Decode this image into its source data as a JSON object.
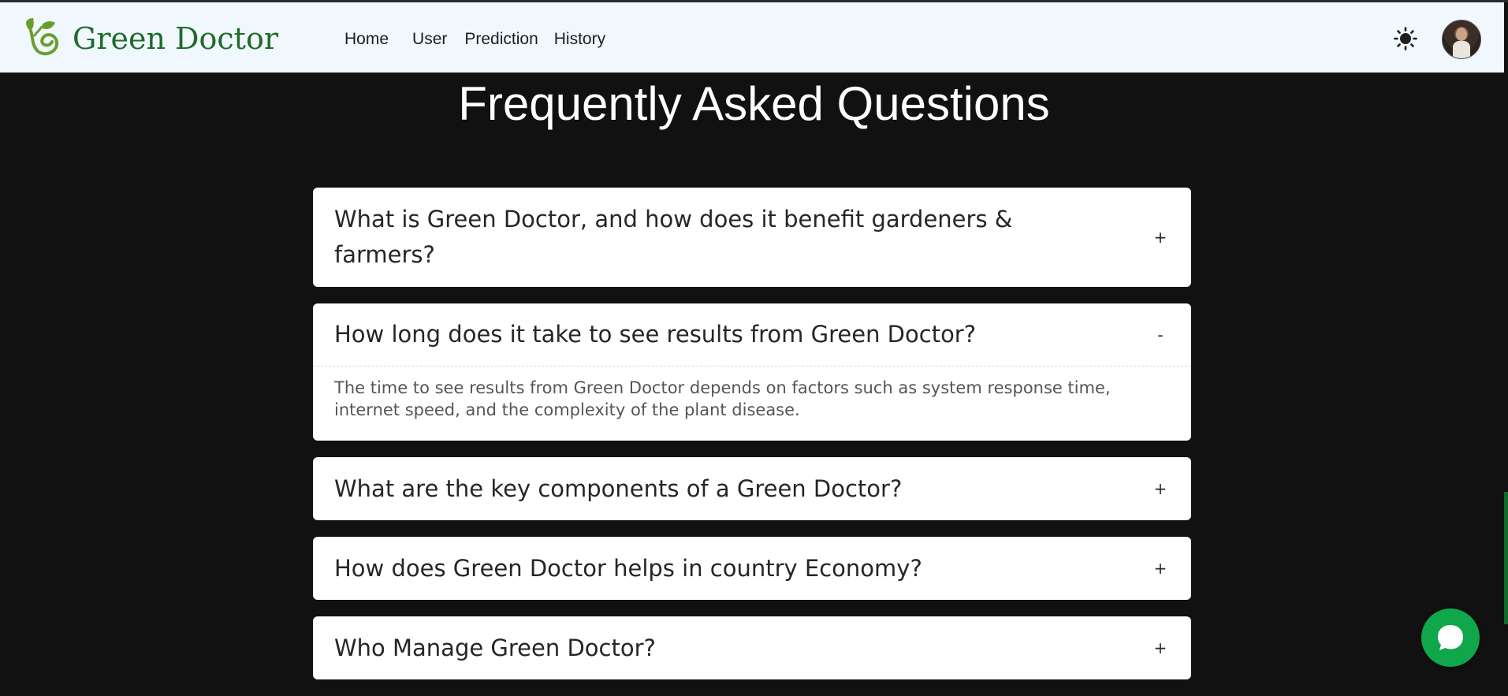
{
  "brand": {
    "name": "Green Doctor",
    "logo_icon": "sprout-logo-icon",
    "logo_color": "#6a9e2c"
  },
  "nav": {
    "items": [
      {
        "label": "Home"
      },
      {
        "label": "User"
      },
      {
        "label": "Prediction"
      },
      {
        "label": "History"
      }
    ]
  },
  "header_actions": {
    "theme_icon": "sun-icon",
    "avatar": "user-avatar"
  },
  "faq": {
    "title": "Frequently Asked Questions",
    "items": [
      {
        "question": "What is Green Doctor, and how does it benefit gardeners & farmers?",
        "toggle": "+",
        "expanded": false
      },
      {
        "question": "How long does it take to see results from Green Doctor?",
        "toggle": "-",
        "expanded": true,
        "answer": "The time to see results from Green Doctor depends on factors such as system response time, internet speed, and the complexity of the plant disease."
      },
      {
        "question": "What are the key components of a Green Doctor?",
        "toggle": "+",
        "expanded": false
      },
      {
        "question": "How does Green Doctor helps in country Economy?",
        "toggle": "+",
        "expanded": false
      },
      {
        "question": "Who Manage Green Doctor?",
        "toggle": "+",
        "expanded": false
      }
    ]
  },
  "chat": {
    "icon": "chat-bubble-icon",
    "color": "#10a64b"
  },
  "colors": {
    "page_bg": "#111111",
    "nav_bg": "#f0f7fd",
    "brand_text": "#1f6b2a"
  }
}
